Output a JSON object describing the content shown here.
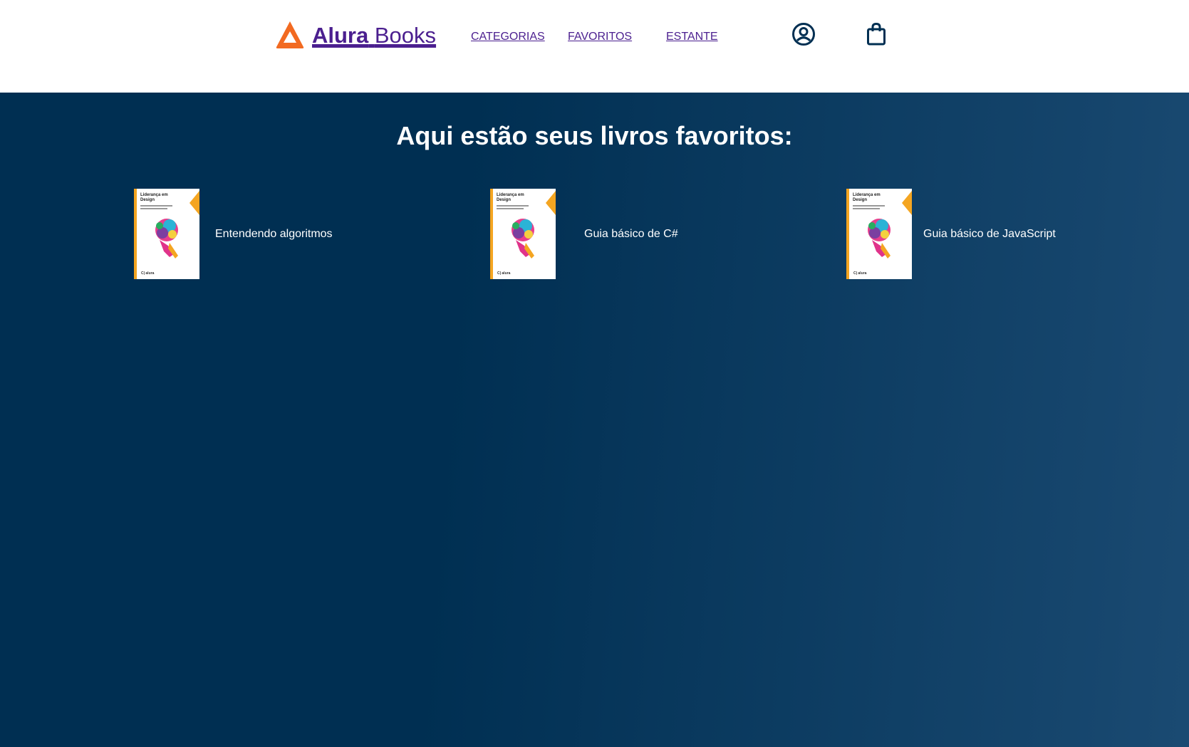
{
  "header": {
    "logo": {
      "bold": "Alura",
      "light": "Books"
    },
    "nav": [
      {
        "label": "CATEGORIAS"
      },
      {
        "label": "FAVORITOS"
      },
      {
        "label": "ESTANTE"
      }
    ],
    "icons": {
      "profile": "user-circle-icon",
      "bag": "shopping-bag-icon"
    }
  },
  "main": {
    "title": "Aqui estão seus livros favoritos:",
    "books": [
      {
        "title": "Entendendo algoritmos",
        "cover_title": "Liderança em Design",
        "cover_footer": "C| alura"
      },
      {
        "title": "Guia básico de C#",
        "cover_title": "Liderança em Design",
        "cover_footer": "C| alura"
      },
      {
        "title": "Guia básico de JavaScript",
        "cover_title": "Liderança em Design",
        "cover_footer": "C| alura"
      }
    ]
  },
  "colors": {
    "brand_orange": "#f26a21",
    "link_purple": "#4b1f8f",
    "icon_navy": "#002f52",
    "bg_dark": "#002f52",
    "bg_light": "#1a4a72",
    "cover_accent": "#f4a521"
  }
}
